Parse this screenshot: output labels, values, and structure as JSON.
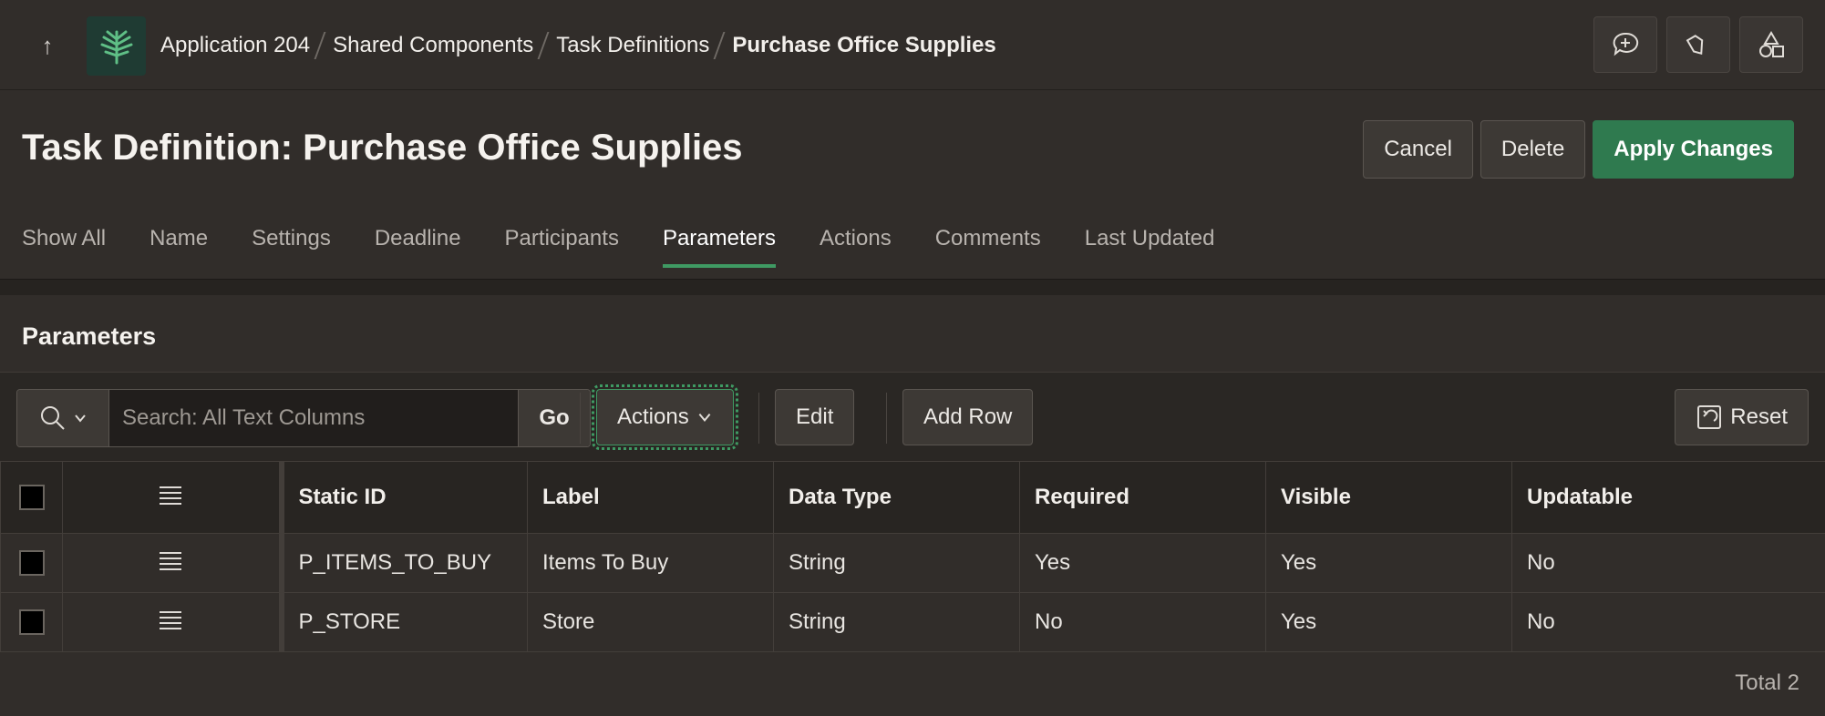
{
  "header": {
    "breadcrumb": [
      "Application 204",
      "Shared Components",
      "Task Definitions",
      "Purchase Office Supplies"
    ]
  },
  "page": {
    "title": "Task Definition: Purchase Office Supplies",
    "cancel_label": "Cancel",
    "delete_label": "Delete",
    "apply_label": "Apply Changes"
  },
  "tabs": [
    "Show All",
    "Name",
    "Settings",
    "Deadline",
    "Participants",
    "Parameters",
    "Actions",
    "Comments",
    "Last Updated"
  ],
  "active_tab": "Parameters",
  "region": {
    "title": "Parameters",
    "search_placeholder": "Search: All Text Columns",
    "go_label": "Go",
    "actions_label": "Actions",
    "edit_label": "Edit",
    "add_row_label": "Add Row",
    "reset_label": "Reset"
  },
  "grid": {
    "columns": [
      "Static ID",
      "Label",
      "Data Type",
      "Required",
      "Visible",
      "Updatable"
    ],
    "rows": [
      [
        "P_ITEMS_TO_BUY",
        "Items To Buy",
        "String",
        "Yes",
        "Yes",
        "No"
      ],
      [
        "P_STORE",
        "Store",
        "String",
        "No",
        "Yes",
        "No"
      ]
    ],
    "total": "Total 2"
  },
  "colors": {
    "accent": "#3f9a63",
    "primary_button": "#2f7a4f",
    "background": "#312d2a"
  }
}
